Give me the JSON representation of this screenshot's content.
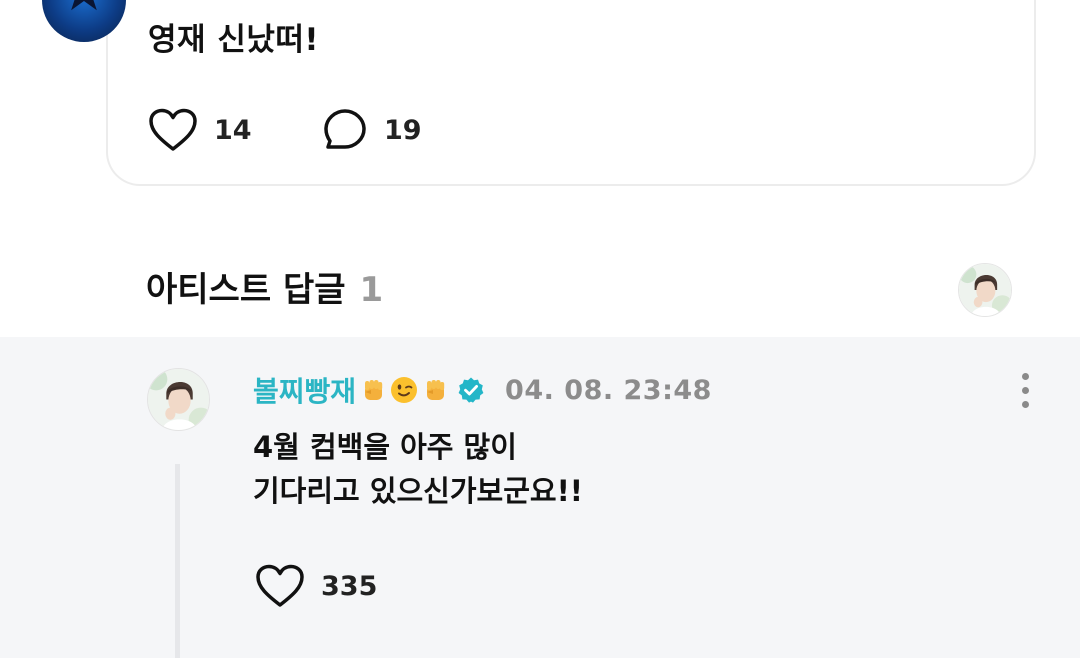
{
  "post": {
    "text": "영재 신났떠!",
    "like_count": "14",
    "comment_count": "19"
  },
  "artist_replies": {
    "title": "아티스트 답글",
    "count": "1"
  },
  "reply": {
    "username": "볼찌빵재",
    "timestamp": "04. 08. 23:48",
    "text_line1": "4월 컴백을 아주 많이",
    "text_line2": "기다리고 있으신가보군요!!",
    "like_count": "335"
  },
  "icons": {
    "like": "heart-outline-icon",
    "comment": "speech-bubble-icon",
    "verified": "verified-badge-icon",
    "more": "vertical-dots-icon",
    "emojis": [
      "raised-fist-emoji",
      "winking-face-emoji",
      "raised-fist-emoji"
    ]
  },
  "colors": {
    "username": "#2bb5c4",
    "verified": "#23b6c8",
    "reply_background": "#f5f6f8"
  }
}
